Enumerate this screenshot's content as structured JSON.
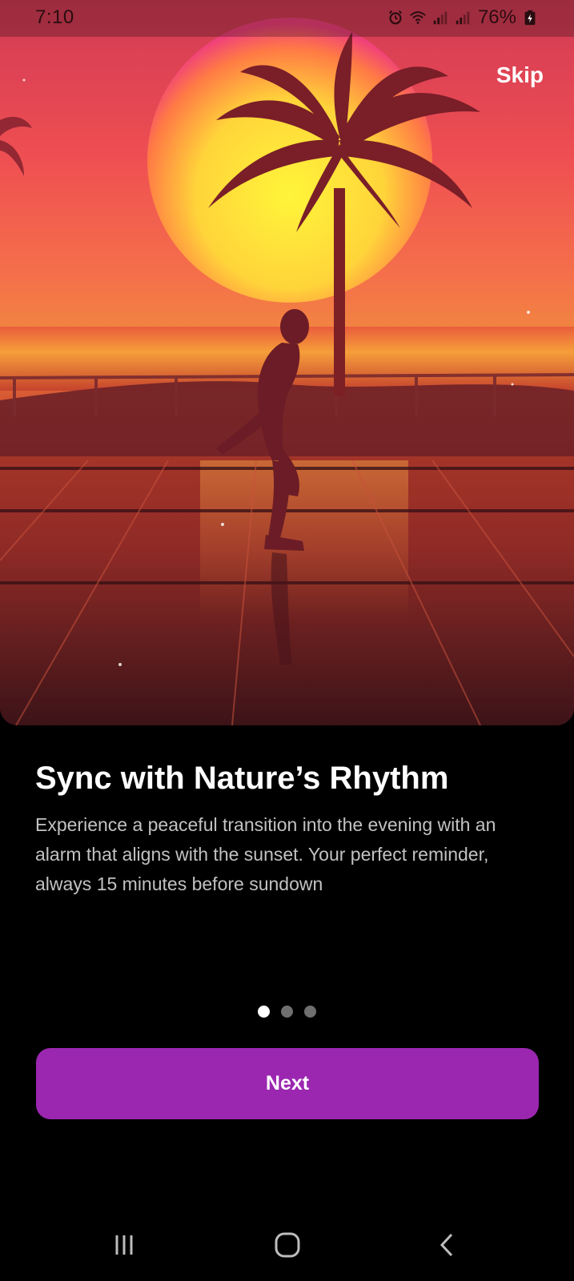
{
  "status_bar": {
    "time": "7:10",
    "battery": "76%",
    "icons": [
      "alarm-icon",
      "wifi-icon",
      "signal-icon",
      "signal-icon",
      "battery-charging-icon"
    ]
  },
  "onboarding": {
    "skip_label": "Skip",
    "title": "Sync with Nature’s Rhythm",
    "description": "Experience a peaceful transition into the evening with an alarm that aligns with the sunset. Your perfect reminder, always 15 minutes before sundown",
    "page_indicator": {
      "current": 1,
      "total": 3
    },
    "next_label": "Next"
  },
  "nav_bar": {
    "icons": [
      "recent-apps-icon",
      "home-icon",
      "back-icon"
    ]
  },
  "colors": {
    "accent": "#9b27b0",
    "background": "#000000",
    "dot_active": "#ffffff",
    "dot_inactive": "#6f6f6f"
  }
}
